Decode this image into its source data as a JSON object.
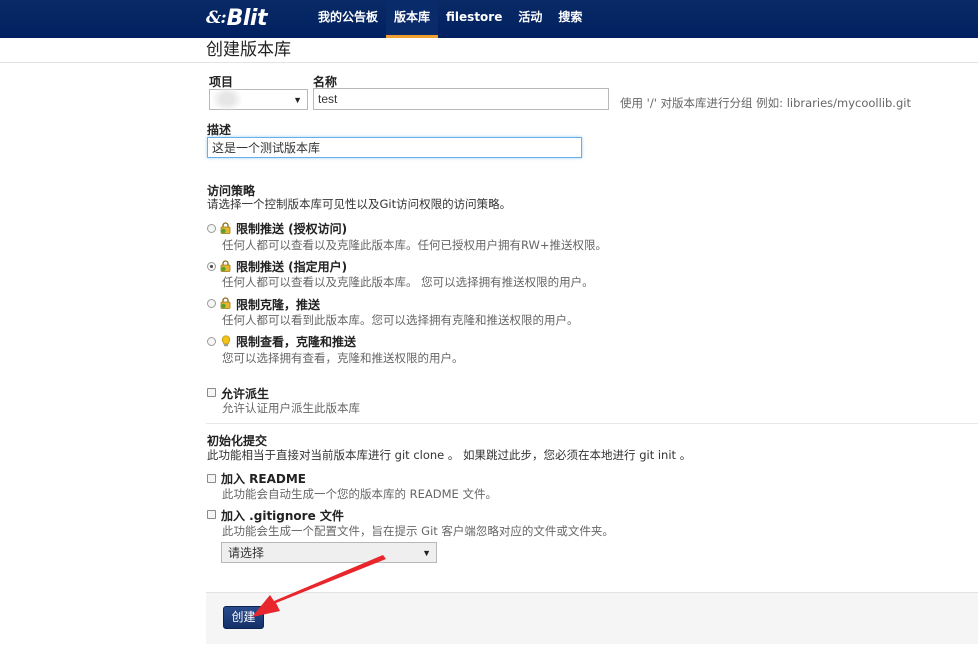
{
  "navbar": {
    "brand_mark": "&:",
    "brand_word": "Blit",
    "items": [
      {
        "label": "我的公告板",
        "active": false
      },
      {
        "label": "版本库",
        "active": true
      },
      {
        "label": "filestore",
        "active": false
      },
      {
        "label": "活动",
        "active": false
      },
      {
        "label": "搜索",
        "active": false
      }
    ]
  },
  "page": {
    "title": "创建版本库"
  },
  "form": {
    "project": {
      "label": "项目",
      "value": ""
    },
    "name": {
      "label": "名称",
      "value": "test",
      "help": "使用 '/' 对版本库进行分组 例如:  libraries/mycoollib.git"
    },
    "description": {
      "label": "描述",
      "value": "这是一个测试版本库"
    },
    "access": {
      "title": "访问策略",
      "intro": "请选择一个控制版本库可见性以及Git访问权限的访问策略。",
      "options": [
        {
          "label": "限制推送 (授权访问)",
          "desc": "任何人都可以查看以及克隆此版本库。任何已授权用户拥有RW+推送权限。",
          "icon": "lock-icon",
          "selected": false
        },
        {
          "label": "限制推送 (指定用户)",
          "desc": "任何人都可以查看以及克隆此版本库。 您可以选择拥有推送权限的用户。",
          "icon": "lock-icon",
          "selected": true
        },
        {
          "label": "限制克隆，推送",
          "desc": "任何人都可以看到此版本库。您可以选择拥有克隆和推送权限的用户。",
          "icon": "lock-icon",
          "selected": false
        },
        {
          "label": "限制查看，克隆和推送",
          "desc": "您可以选择拥有查看，克隆和推送权限的用户。",
          "icon": "bulb-icon",
          "selected": false
        }
      ]
    },
    "fork": {
      "label": "允许派生",
      "desc": "允许认证用户派生此版本库"
    },
    "init": {
      "title": "初始化提交",
      "intro": "此功能相当于直接对当前版本库进行 git clone 。 如果跳过此步，您必须在本地进行 git init 。",
      "readme": {
        "label": "加入 README",
        "desc": "此功能会自动生成一个您的版本库的 README 文件。"
      },
      "gitignore": {
        "label": "加入 .gitignore 文件",
        "desc": "此功能会生成一个配置文件，旨在提示 Git 客户端忽略对应的文件或文件夹。"
      },
      "gitignore_select": "请选择"
    },
    "submit_label": "创建"
  },
  "colors": {
    "navbar": "#002060",
    "accent": "#f0a030",
    "button": "#1e3a78",
    "arrow": "#e8262c"
  }
}
